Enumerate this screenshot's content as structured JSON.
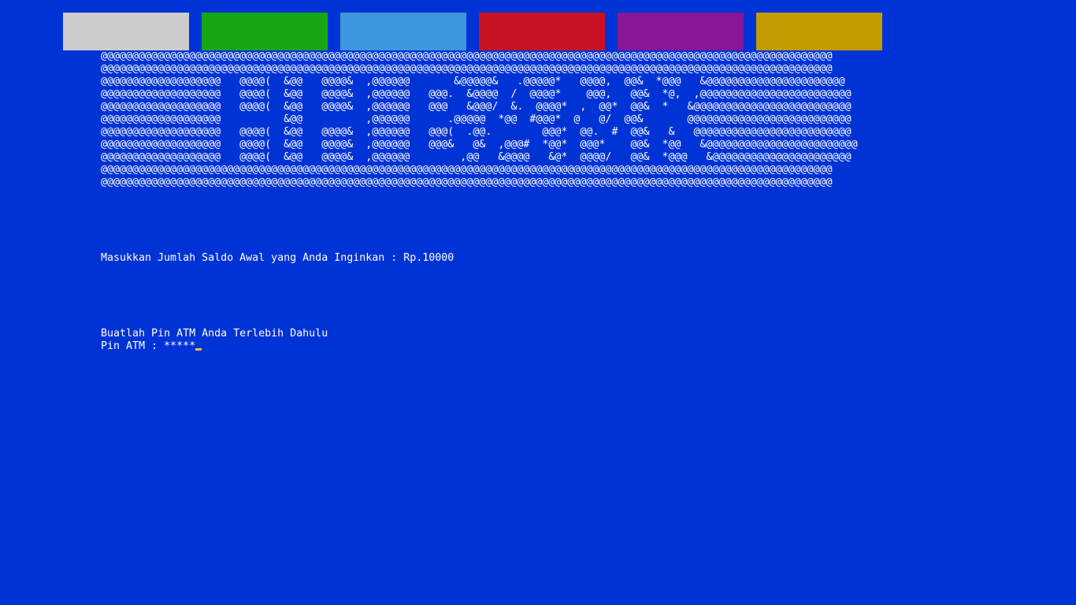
{
  "color_bar": {
    "swatches": [
      {
        "name": "gray",
        "color": "#cccccc"
      },
      {
        "name": "green",
        "color": "#18a714"
      },
      {
        "name": "light-blue",
        "color": "#3d97df"
      },
      {
        "name": "red",
        "color": "#c81224"
      },
      {
        "name": "purple",
        "color": "#881798"
      },
      {
        "name": "gold",
        "color": "#c19c00"
      }
    ]
  },
  "ascii_banner": {
    "lines": [
      "@@@@@@@@@@@@@@@@@@@@@@@@@@@@@@@@@@@@@@@@@@@@@@@@@@@@@@@@@@@@@@@@@@@@@@@@@@@@@@@@@@@@@@@@@@@@@@@@@@@@@@@@@@@@@@@@@@@@",
      "@@@@@@@@@@@@@@@@@@@@@@@@@@@@@@@@@@@@@@@@@@@@@@@@@@@@@@@@@@@@@@@@@@@@@@@@@@@@@@@@@@@@@@@@@@@@@@@@@@@@@@@@@@@@@@@@@@@@",
      "@@@@@@@@@@@@@@@@@@@   @@@@(  &@@   @@@@&  ,@@@@@@       &@@@@@&   .@@@@@*   @@@@,  @@&  *@@@   &@@@@@@@@@@@@@@@@@@@@@@",
      "@@@@@@@@@@@@@@@@@@@   @@@@(  &@@   @@@@&  ,@@@@@@   @@@.  &@@@@  /  @@@@*    @@@,   @@&  *@,  ,@@@@@@@@@@@@@@@@@@@@@@@@",
      "@@@@@@@@@@@@@@@@@@@   @@@@(  &@@   @@@@&  ,@@@@@@   @@@   &@@@/  &.  @@@@*  ,  @@*  @@&  *   &@@@@@@@@@@@@@@@@@@@@@@@@@",
      "@@@@@@@@@@@@@@@@@@@          &@@          ,@@@@@@      .@@@@@  *@@  #@@@*  @   @/  @@&       @@@@@@@@@@@@@@@@@@@@@@@@@@",
      "@@@@@@@@@@@@@@@@@@@   @@@@(  &@@   @@@@&  ,@@@@@@   @@@(  .@@.        @@@*  @@.  #  @@&   &   @@@@@@@@@@@@@@@@@@@@@@@@@",
      "@@@@@@@@@@@@@@@@@@@   @@@@(  &@@   @@@@&  ,@@@@@@   @@@&   @&  ,@@@#  *@@*  @@@*    @@&  *@@   &@@@@@@@@@@@@@@@@@@@@@@@@",
      "@@@@@@@@@@@@@@@@@@@   @@@@(  &@@   @@@@&  ,@@@@@@        ,@@   &@@@@   &@*  @@@@/   @@&  *@@@   &@@@@@@@@@@@@@@@@@@@@@@",
      "@@@@@@@@@@@@@@@@@@@@@@@@@@@@@@@@@@@@@@@@@@@@@@@@@@@@@@@@@@@@@@@@@@@@@@@@@@@@@@@@@@@@@@@@@@@@@@@@@@@@@@@@@@@@@@@@@@@@",
      "@@@@@@@@@@@@@@@@@@@@@@@@@@@@@@@@@@@@@@@@@@@@@@@@@@@@@@@@@@@@@@@@@@@@@@@@@@@@@@@@@@@@@@@@@@@@@@@@@@@@@@@@@@@@@@@@@@@@"
    ]
  },
  "prompts": {
    "saldo_line": "Masukkan Jumlah Saldo Awal yang Anda Inginkan : Rp.10000",
    "pin_title": "Buatlah Pin ATM Anda Terlebih Dahulu",
    "pin_input": "Pin ATM : *****"
  },
  "cursor": {
    "color": "#f2c230"
  }
}
